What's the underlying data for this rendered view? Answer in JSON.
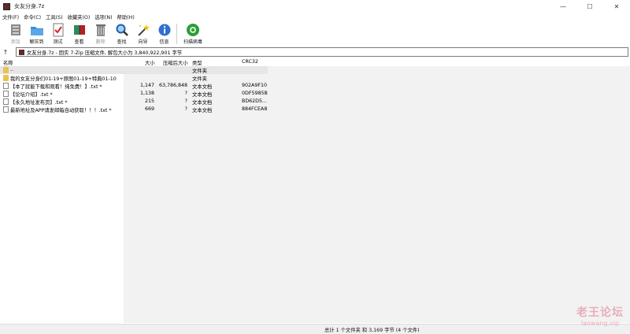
{
  "window": {
    "title": "女友分身.7z",
    "minimize_glyph": "—",
    "maximize_glyph": "☐",
    "close_glyph": "✕"
  },
  "menu": [
    "文件(F)",
    "命令(C)",
    "工具(S)",
    "收藏夹(O)",
    "选项(N)",
    "帮助(H)"
  ],
  "toolbar": {
    "items": [
      {
        "label": "添加",
        "icon": "add-icon",
        "disabled": true
      },
      {
        "label": "解压到",
        "icon": "extract-folder-icon",
        "disabled": false
      },
      {
        "label": "测试",
        "icon": "test-icon",
        "disabled": false
      },
      {
        "label": "查看",
        "icon": "view-book-icon",
        "disabled": false
      },
      {
        "label": "删除",
        "icon": "delete-trash-icon",
        "disabled": true
      },
      {
        "label": "查找",
        "icon": "find-magnifier-icon",
        "disabled": false
      },
      {
        "label": "向导",
        "icon": "wizard-icon",
        "disabled": false
      },
      {
        "label": "信息",
        "icon": "info-icon",
        "disabled": false
      },
      {
        "label": "扫描病毒",
        "icon": "virus-scan-icon",
        "disabled": false
      }
    ]
  },
  "address": {
    "up_glyph": "↑",
    "path_text": "女友分身.7z - 固实 7-Zip 压缩文件, 解包大小为 3,840,922,901 字节"
  },
  "columns": {
    "name": "名称",
    "size": "大小",
    "packed": "压缩后大小",
    "type": "类型",
    "crc": "CRC32"
  },
  "rows": [
    {
      "name": "..",
      "size": "",
      "packed": "",
      "type": "文件夹",
      "crc": "",
      "kind": "folder",
      "selected": true
    },
    {
      "name": "我的女友分身们01-19+原图01-19+特典01-10",
      "size": "",
      "packed": "",
      "type": "文件夹",
      "crc": "",
      "kind": "folder",
      "selected": false
    },
    {
      "name": "【本了就能下载和观看！纯免费！】.txt *",
      "size": "1,147",
      "packed": "63,786,848",
      "type": "文本文档",
      "crc": "902A9F10",
      "kind": "txt",
      "selected": false
    },
    {
      "name": "【论坛介绍】.txt *",
      "size": "1,138",
      "packed": "?",
      "type": "文本文档",
      "crc": "0DF5985B",
      "kind": "txt",
      "selected": false
    },
    {
      "name": "【永久地址发布页】.txt *",
      "size": "215",
      "packed": "?",
      "type": "文本文档",
      "crc": "BD62D5...",
      "kind": "txt",
      "selected": false
    },
    {
      "name": "最新地址及APP请发邮箱自动获取！！！.txt *",
      "size": "669",
      "packed": "?",
      "type": "文本文档",
      "crc": "884FCEA8",
      "kind": "txt",
      "selected": false
    }
  ],
  "status": {
    "text": "总计 1 个文件夹 和 3,169 字节 (4 个文件)"
  },
  "watermark": {
    "line1": "老王论坛",
    "line2": "laowang.vip"
  }
}
